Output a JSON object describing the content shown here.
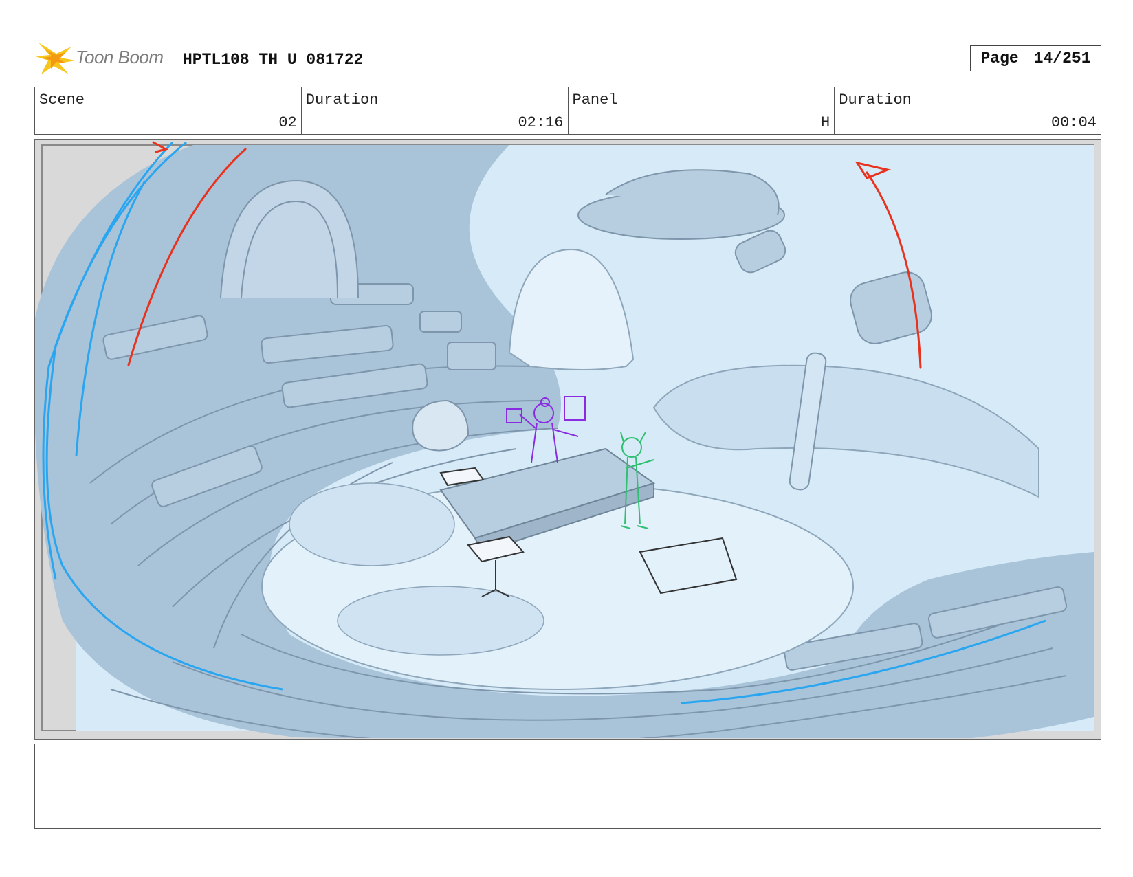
{
  "header": {
    "logo_text": "Toon Boom",
    "project_title": "HPTL108 TH U 081722",
    "page_label": "Page",
    "page_number": "14/251"
  },
  "info": {
    "scene_label": "Scene",
    "scene_value": "02",
    "scene_duration_label": "Duration",
    "scene_duration_value": "02:16",
    "panel_label": "Panel",
    "panel_value": "H",
    "panel_duration_label": "Duration",
    "panel_duration_value": "00:04"
  },
  "panel": {
    "camera_move_arrow_color": "#e8321e",
    "rough_stroke_color": "#2aa6f0",
    "scene_fill_color": "#d6eaf8",
    "shadow_fill_color": "#a9c3d9",
    "character_1_color": "#8a2be2",
    "character_2_color": "#2fbf71"
  },
  "notes": {
    "action_text": ""
  }
}
